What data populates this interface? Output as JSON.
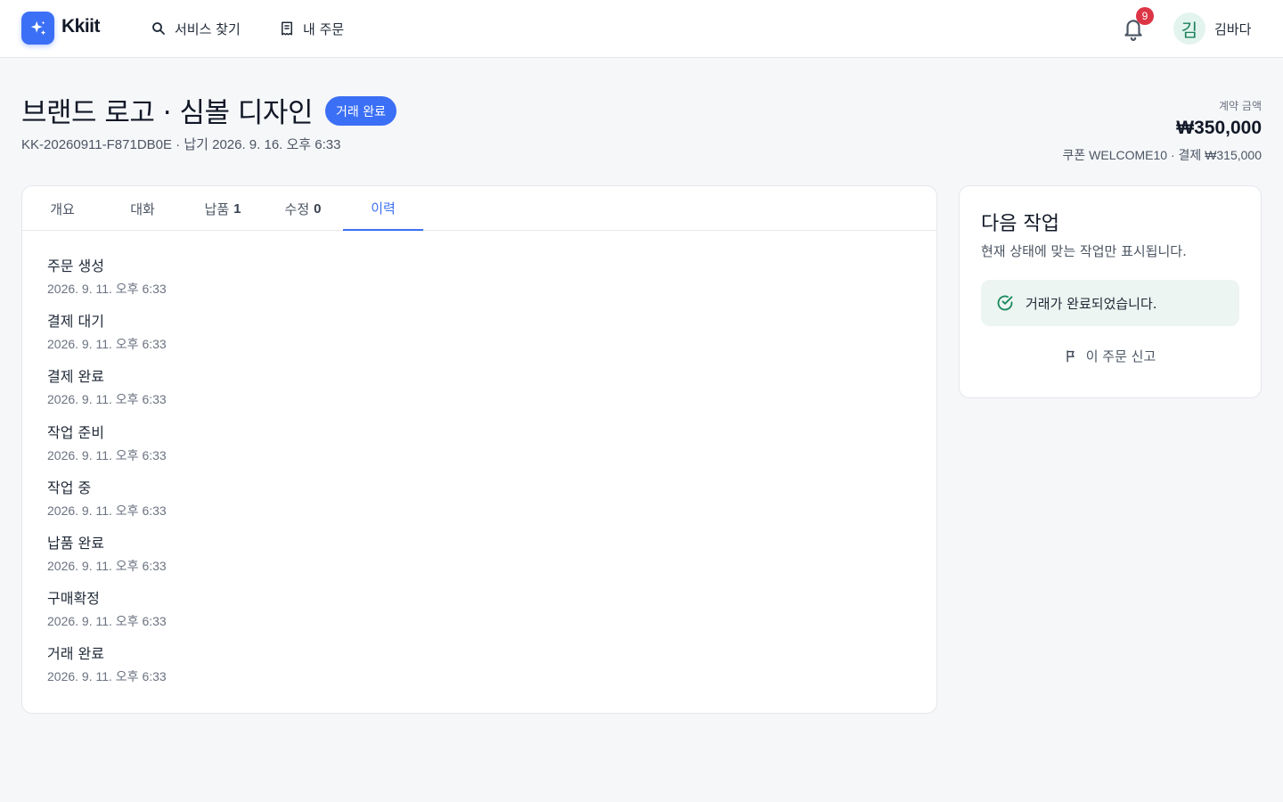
{
  "header": {
    "brand": "Kkiit",
    "nav": [
      {
        "label": "서비스 찾기",
        "icon": "search-icon"
      },
      {
        "label": "내 주문",
        "icon": "receipt-icon"
      }
    ],
    "notification_count": "9",
    "avatar_initial": "김",
    "user_name": "김바다",
    "accent_color": "#3b6ff5"
  },
  "order": {
    "title": "브랜드 로고 · 심볼 디자인",
    "status": "거래 완료",
    "meta": "KK-20260911-F871DB0E · 납기 2026. 9. 16. 오후 6:33",
    "contract_label": "계약 금액",
    "contract_amount": "₩350,000",
    "coupon_line": "쿠폰 WELCOME10 · 결제 ₩315,000"
  },
  "tabs": [
    {
      "label": "개요",
      "count": ""
    },
    {
      "label": "대화",
      "count": ""
    },
    {
      "label": "납품",
      "count": "1"
    },
    {
      "label": "수정",
      "count": "0"
    },
    {
      "label": "이력",
      "count": "",
      "active": true
    }
  ],
  "history": [
    {
      "title": "주문 생성",
      "time": "2026. 9. 11. 오후 6:33"
    },
    {
      "title": "결제 대기",
      "time": "2026. 9. 11. 오후 6:33"
    },
    {
      "title": "결제 완료",
      "time": "2026. 9. 11. 오후 6:33"
    },
    {
      "title": "작업 준비",
      "time": "2026. 9. 11. 오후 6:33"
    },
    {
      "title": "작업 중",
      "time": "2026. 9. 11. 오후 6:33"
    },
    {
      "title": "납품 완료",
      "time": "2026. 9. 11. 오후 6:33"
    },
    {
      "title": "구매확정",
      "time": "2026. 9. 11. 오후 6:33"
    },
    {
      "title": "거래 완료",
      "time": "2026. 9. 11. 오후 6:33"
    }
  ],
  "next_action": {
    "title": "다음 작업",
    "description": "현재 상태에 맞는 작업만 표시됩니다.",
    "completed_message": "거래가 완료되었습니다.",
    "report_label": "이 주문 신고"
  }
}
